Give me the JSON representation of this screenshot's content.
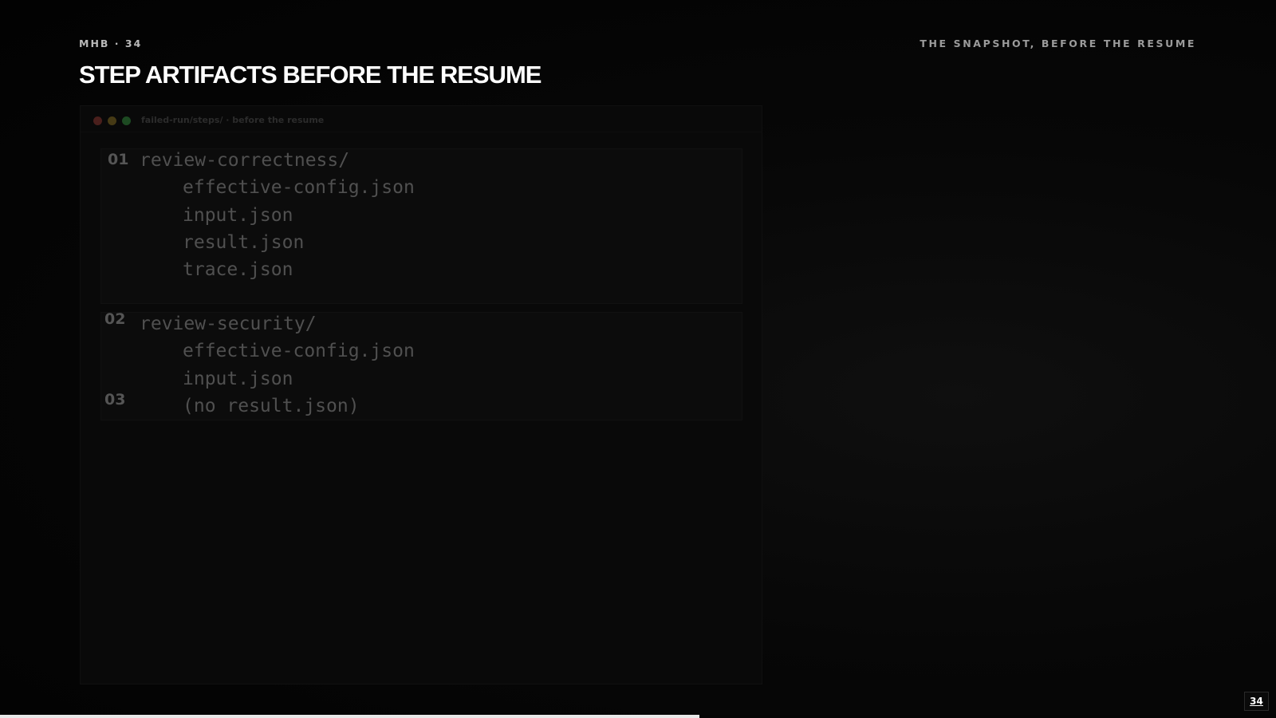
{
  "header": {
    "kicker": "MHB · 34",
    "section": "THE SNAPSHOT, BEFORE THE RESUME",
    "title": "STEP ARTIFACTS BEFORE THE RESUME"
  },
  "window": {
    "label": "failed-run/steps/ · before the resume",
    "dot_colors": [
      "#4a1f1c",
      "#463a15",
      "#1d4a22"
    ]
  },
  "steps": [
    {
      "number": "01",
      "dir": "review-correctness/",
      "files": [
        "effective-config.json",
        "input.json",
        "result.json",
        "trace.json"
      ]
    },
    {
      "number": "02",
      "dir": "review-security/",
      "files": [
        "effective-config.json",
        "input.json"
      ]
    },
    {
      "number": "03",
      "note": "(no result.json)"
    }
  ],
  "footer": {
    "page_number": "34",
    "progress": 0.548
  }
}
